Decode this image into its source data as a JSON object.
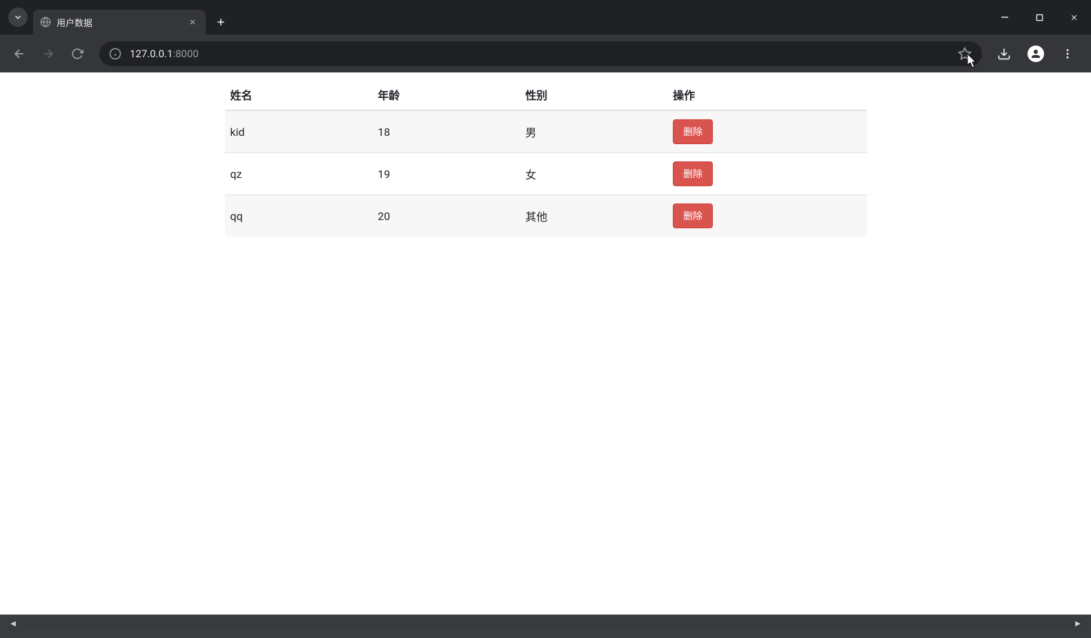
{
  "browser": {
    "tab_title": "用户数据",
    "url_host": "127.0.0.1",
    "url_port": ":8000"
  },
  "table": {
    "headers": {
      "name": "姓名",
      "age": "年龄",
      "gender": "性别",
      "action": "操作"
    },
    "rows": [
      {
        "name": "kid",
        "age": "18",
        "gender": "男",
        "action": "删除"
      },
      {
        "name": "qz",
        "age": "19",
        "gender": "女",
        "action": "删除"
      },
      {
        "name": "qq",
        "age": "20",
        "gender": "其他",
        "action": "删除"
      }
    ]
  }
}
